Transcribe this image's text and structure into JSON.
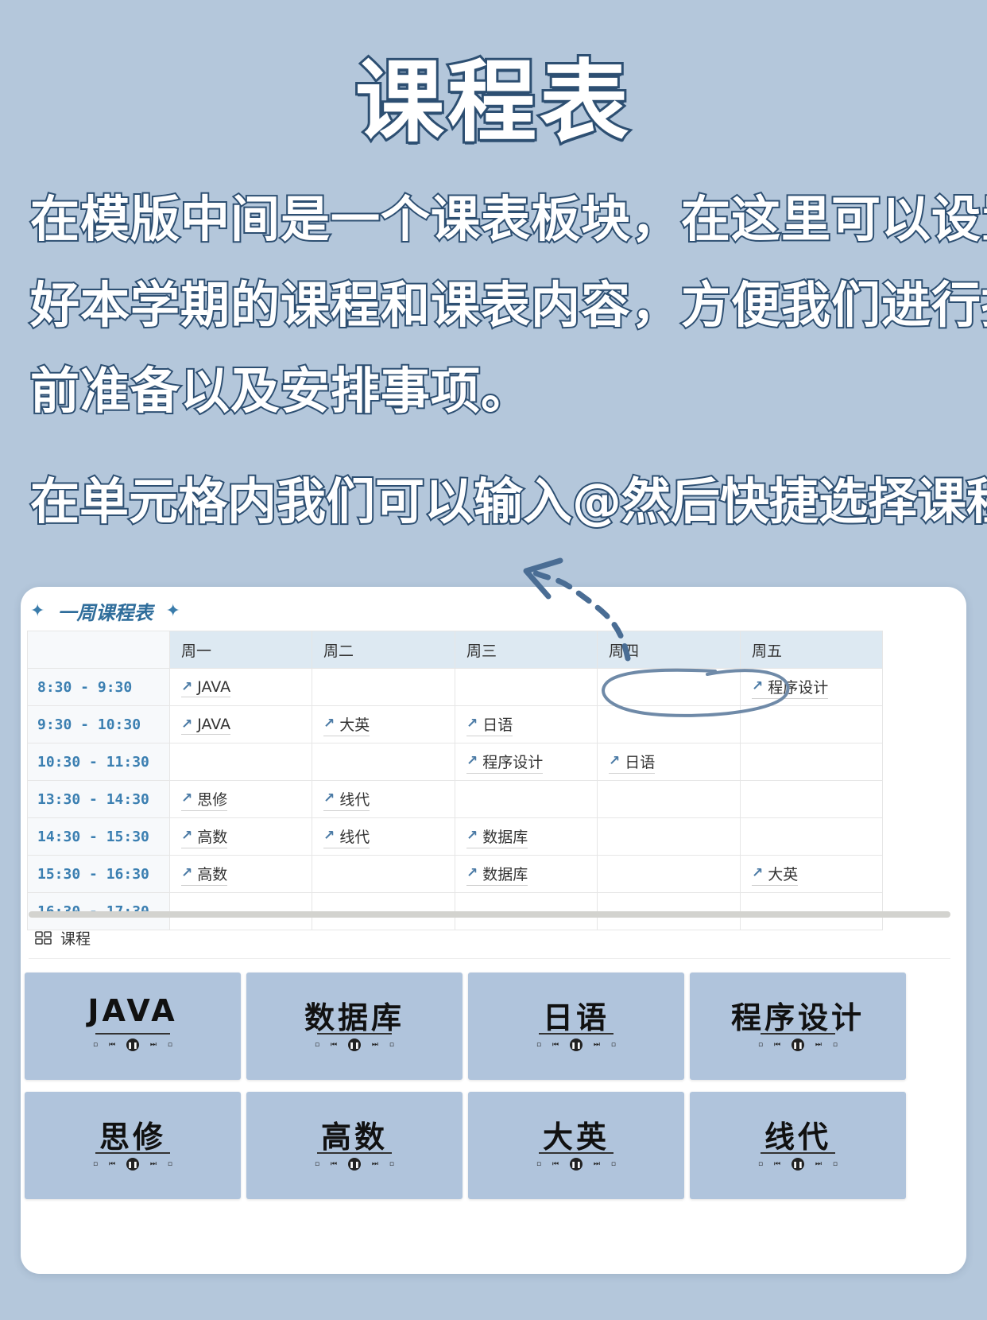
{
  "hero": {
    "title": "课程表",
    "intro_lines": [
      "在模版中间是一个课表板块，在这里可以设置",
      "好本学期的课程和课表内容，方便我们进行提",
      "前准备以及安排事项。"
    ],
    "hint": "在单元格内我们可以输入@然后快捷选择课程"
  },
  "card": {
    "heading": "一周课程表",
    "sparkle_icon": "✦",
    "days": [
      "周一",
      "周二",
      "周三",
      "周四",
      "周五"
    ],
    "times": [
      "8:30 - 9:30",
      "9:30 - 10:30",
      "10:30 - 11:30",
      "13:30 - 14:30",
      "14:30 - 15:30",
      "15:30 - 16:30",
      "16:30 - 17:30"
    ],
    "cells": [
      [
        "JAVA",
        "",
        "",
        "",
        "程序设计"
      ],
      [
        "JAVA",
        "大英",
        "日语",
        "",
        ""
      ],
      [
        "",
        "",
        "程序设计",
        "日语",
        ""
      ],
      [
        "思修",
        "线代",
        "",
        "",
        ""
      ],
      [
        "高数",
        "线代",
        "数据库",
        "",
        ""
      ],
      [
        "高数",
        "",
        "数据库",
        "",
        "大英"
      ],
      [
        "",
        "",
        "",
        "",
        ""
      ]
    ],
    "link_arrow_icon": "↗",
    "gallery": {
      "icon": "grid-icon",
      "title": "课程",
      "courses": [
        "JAVA",
        "数据库",
        "日语",
        "程序设计",
        "思修",
        "高数",
        "大英",
        "线代"
      ]
    }
  },
  "colors": {
    "background": "#b4c7db",
    "title_outline": "#2d4f72",
    "accent": "#3b7fb1",
    "header_fill": "#dde9f2",
    "tile_fill": "#b0c4dc"
  }
}
